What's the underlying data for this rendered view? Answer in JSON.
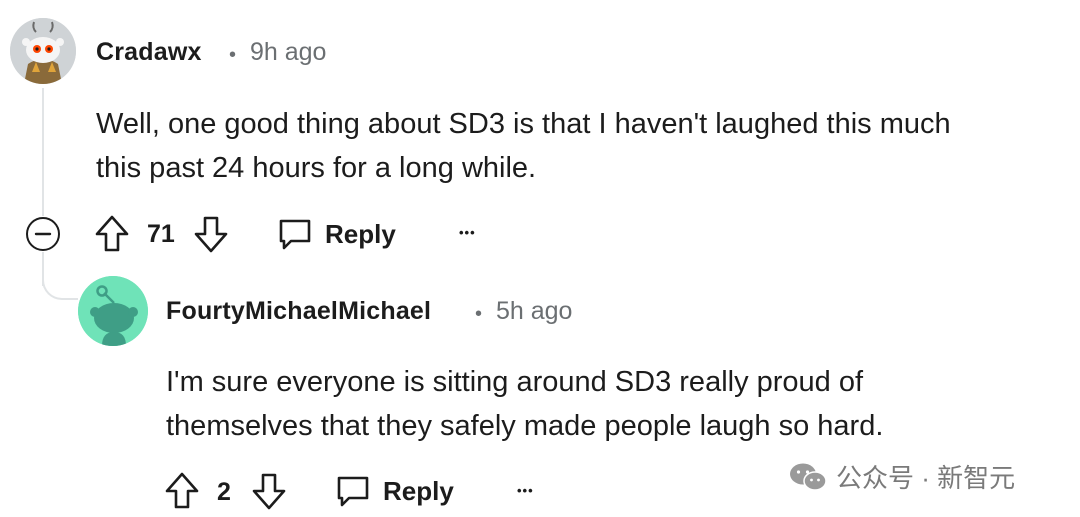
{
  "comments": [
    {
      "username": "Cradawx",
      "separator": "•",
      "time": "9h ago",
      "text_lines": [
        "Well, one good thing about SD3 is that I haven't laughed this much",
        "this past 24 hours for a long while."
      ],
      "votes": "71",
      "reply_label": "Reply",
      "more_label": "•••"
    },
    {
      "username": "FourtyMichaelMichael",
      "separator": "•",
      "time": "5h ago",
      "text_lines": [
        "I'm sure everyone is sitting around SD3 really proud of",
        "themselves that they safely made people laugh so hard."
      ],
      "votes": "2",
      "reply_label": "Reply",
      "more_label": "•••"
    }
  ],
  "watermark": {
    "text": "公众号 · 新智元",
    "icon": "wechat-icon"
  },
  "colors": {
    "avatar2_bg": "#6fe3b8",
    "thread_line": "#e1e4e6",
    "meta_gray": "#6b6f72"
  }
}
